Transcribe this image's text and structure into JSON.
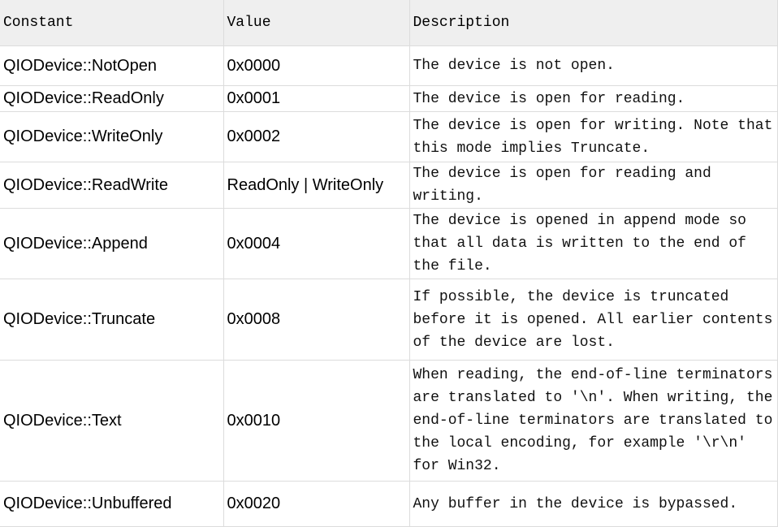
{
  "headers": [
    "Constant",
    "Value",
    "Description"
  ],
  "rows": [
    {
      "constant": "QIODevice::NotOpen",
      "value": "0x0000",
      "description": "The device is not open."
    },
    {
      "constant": "QIODevice::ReadOnly",
      "value": "0x0001",
      "description": "The device is open for reading."
    },
    {
      "constant": "QIODevice::WriteOnly",
      "value": "0x0002",
      "description": "The device is open for writing. Note that this mode implies Truncate."
    },
    {
      "constant": "QIODevice::ReadWrite",
      "value": "ReadOnly | WriteOnly",
      "description": "The device is open for reading and writing."
    },
    {
      "constant": "QIODevice::Append",
      "value": "0x0004",
      "description": "The device is opened in append mode so that all data is written to the end of the file."
    },
    {
      "constant": "QIODevice::Truncate",
      "value": "0x0008",
      "description": "If possible, the device is truncated before it is opened. All earlier contents of the device are lost."
    },
    {
      "constant": "QIODevice::Text",
      "value": "0x0010",
      "description": "When reading, the end-of-line terminators are translated to '\\n'. When writing, the end-of-line terminators are translated to the local encoding, for example '\\r\\n' for Win32."
    },
    {
      "constant": "QIODevice::Unbuffered",
      "value": "0x0020",
      "description": "Any buffer in the device is bypassed."
    }
  ]
}
